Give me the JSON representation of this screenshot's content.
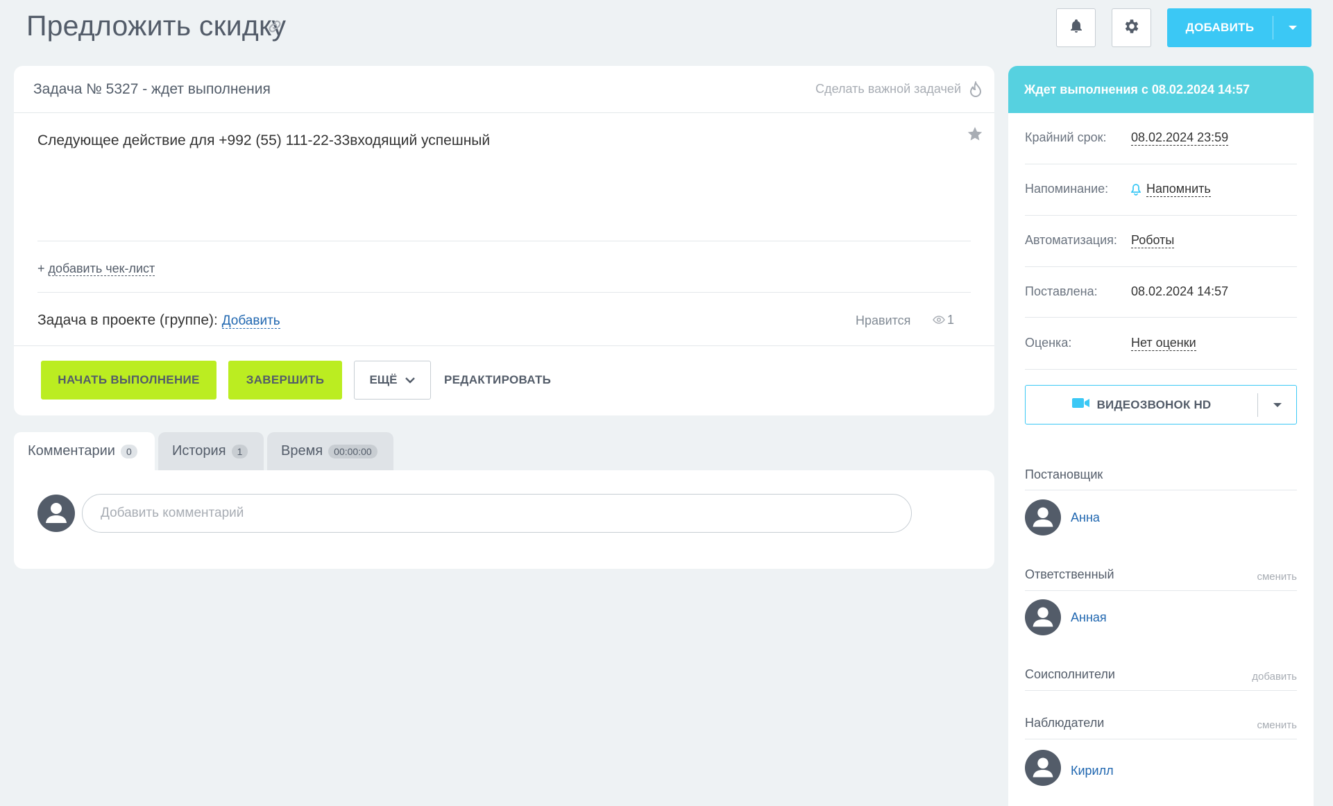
{
  "header": {
    "title": "Предложить скидку",
    "add_label": "ДОБАВИТЬ"
  },
  "task": {
    "head_title": "Задача № 5327 - ждет выполнения",
    "make_important": "Сделать важной задачей",
    "description": "Следующее действие для +992 (55) 111-22-33входящий успешный",
    "add_checklist_plus": "+",
    "add_checklist": "добавить чек-лист",
    "project_label": "Задача в проекте (группе):",
    "project_add": "Добавить",
    "like": "Нравится",
    "views": "1",
    "buttons": {
      "start": "НАЧАТЬ ВЫПОЛНЕНИЕ",
      "complete": "ЗАВЕРШИТЬ",
      "more": "ЕЩЁ",
      "edit": "РЕДАКТИРОВАТЬ"
    }
  },
  "tabs": [
    {
      "label": "Комментарии",
      "badge": "0"
    },
    {
      "label": "История",
      "badge": "1"
    },
    {
      "label": "Время",
      "badge": "00:00:00"
    }
  ],
  "comments": {
    "placeholder": "Добавить комментарий"
  },
  "sidebar": {
    "status": "Ждет выполнения с 08.02.2024 14:57",
    "props": [
      {
        "label": "Крайний срок:",
        "value": "08.02.2024 23:59"
      },
      {
        "label": "Напоминание:",
        "value": "Напомнить"
      },
      {
        "label": "Автоматизация:",
        "value": "Роботы"
      },
      {
        "label": "Поставлена:",
        "value": "08.02.2024 14:57"
      },
      {
        "label": "Оценка:",
        "value": "Нет оценки"
      }
    ],
    "video_label": "ВИДЕОЗВОНОК HD",
    "sections": {
      "creator": {
        "title": "Постановщик",
        "person": "Анна"
      },
      "responsible": {
        "title": "Ответственный",
        "action": "сменить",
        "person": "Анная"
      },
      "coexecutors": {
        "title": "Соисполнители",
        "action": "добавить"
      },
      "observers": {
        "title": "Наблюдатели",
        "action": "сменить",
        "person": "Кирилл"
      }
    }
  },
  "colors": {
    "accent_blue": "#3bc8f5",
    "status_cyan": "#56d1e0",
    "action_green": "#bbed21",
    "link_blue": "#2067b0"
  }
}
